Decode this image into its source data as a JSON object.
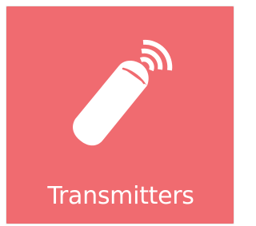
{
  "tile": {
    "label": "Transmitters",
    "icon": "remote-transmitter-icon",
    "background_color": "#f06b70",
    "foreground_color": "#ffffff"
  }
}
